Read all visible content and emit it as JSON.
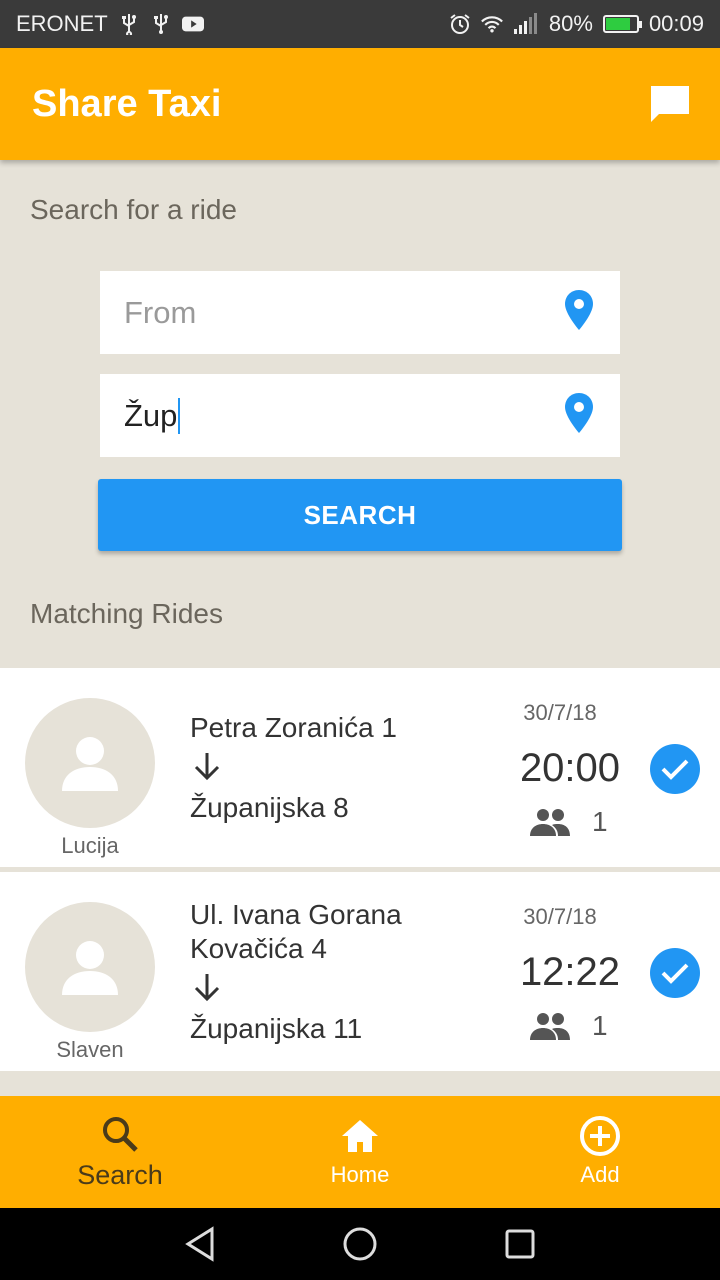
{
  "status_bar": {
    "carrier": "ERONET",
    "battery": "80%",
    "battery_level": 0.8,
    "time": "00:09",
    "icons": [
      "usb-icon",
      "usb-icon",
      "youtube-icon",
      "alarm-icon",
      "wifi-icon",
      "signal-icon",
      "battery-icon"
    ]
  },
  "app_bar": {
    "title": "Share Taxi",
    "action_icon": "chat-icon"
  },
  "search": {
    "section_label": "Search for a ride",
    "from_placeholder": "From",
    "from_value": "",
    "to_value": "Žup",
    "button_label": "SEARCH",
    "field_icon": "location-pin-icon"
  },
  "rides": {
    "section_label": "Matching Rides",
    "items": [
      {
        "driver": "Lucija",
        "from": "Petra Zoranića 1",
        "to": "Županijska 8",
        "date": "30/7/18",
        "time": "20:00",
        "seats": "1"
      },
      {
        "driver": "Slaven",
        "from": "Ul. Ivana Gorana Kovačića 4",
        "to": "Županijska 11",
        "date": "30/7/18",
        "time": "12:22",
        "seats": "1"
      }
    ]
  },
  "bottom_nav": {
    "items": [
      {
        "label": "Search",
        "icon": "search-icon",
        "active": true
      },
      {
        "label": "Home",
        "icon": "home-icon",
        "active": false
      },
      {
        "label": "Add",
        "icon": "add-circle-icon",
        "active": false
      }
    ]
  },
  "colors": {
    "primary": "#ffae00",
    "accent": "#2196f3",
    "background": "#e6e2d8"
  }
}
